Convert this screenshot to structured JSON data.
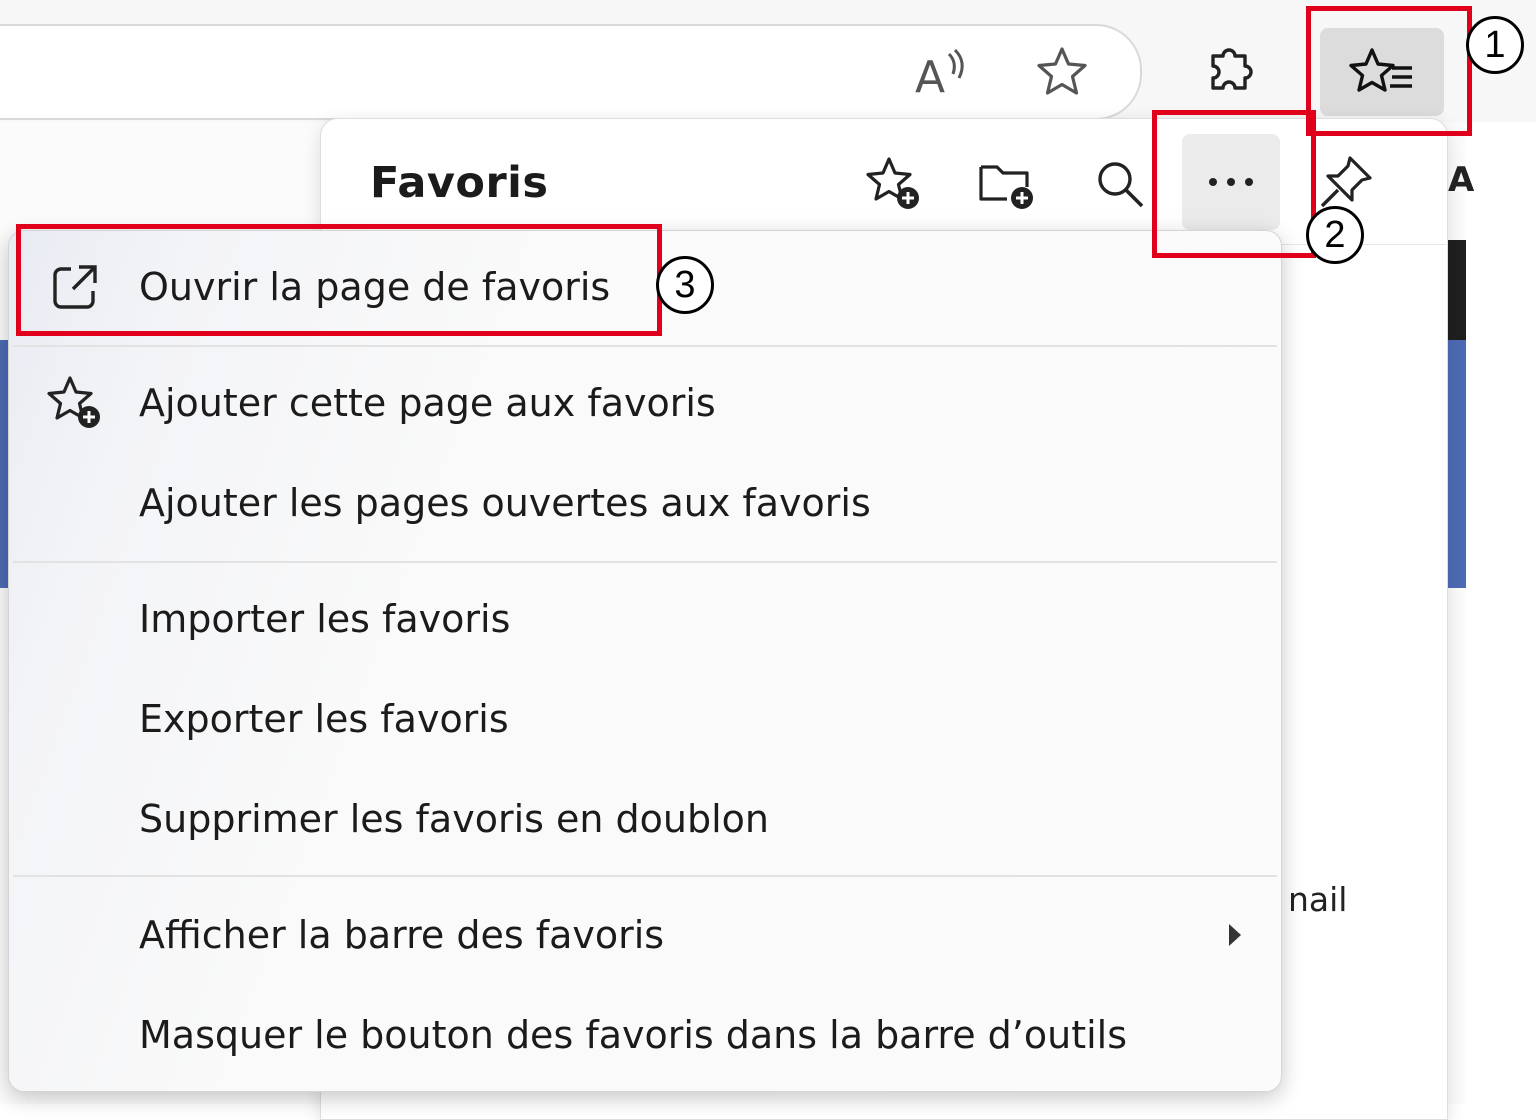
{
  "toolbar": {
    "icons": [
      "read-aloud-icon",
      "add-favorite-icon",
      "extensions-icon",
      "favorites-icon"
    ]
  },
  "favorites_panel": {
    "title": "Favoris",
    "header_icons": [
      "add-favorite-icon",
      "add-folder-icon",
      "search-icon",
      "more-icon",
      "pin-icon"
    ],
    "partial_label_right": "nail",
    "partial_letter": "A"
  },
  "menu": {
    "items": [
      {
        "label": "Ouvrir la page de favoris",
        "icon": "open-external-icon"
      },
      {
        "label": "Ajouter cette page aux favoris",
        "icon": "star-add-icon"
      },
      {
        "label": "Ajouter les pages ouvertes aux favoris"
      },
      {
        "label": "Importer les favoris"
      },
      {
        "label": "Exporter les favoris"
      },
      {
        "label": "Supprimer les favoris en doublon"
      },
      {
        "label": "Afficher la barre des favoris",
        "icon": "submenu-arrow-icon"
      },
      {
        "label": "Masquer le bouton des favoris dans la barre d’outils"
      }
    ]
  },
  "annotations": {
    "badges": [
      "1",
      "2",
      "3"
    ],
    "accent": "#e0001b"
  }
}
